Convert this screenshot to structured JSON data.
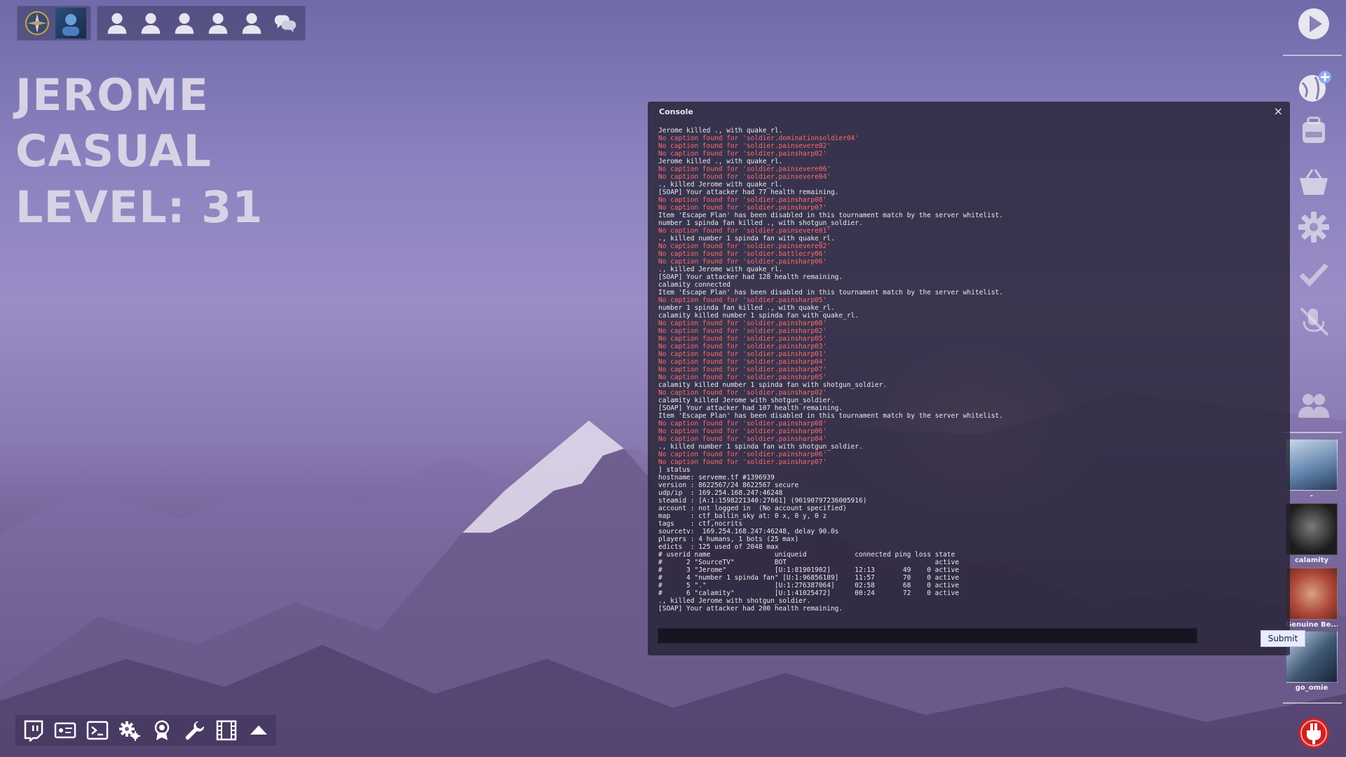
{
  "player": {
    "name": "JEROME",
    "mode": "CASUAL",
    "level": "LEVEL: 31"
  },
  "party_bar": {
    "icons": [
      "compass-icon",
      "avatar",
      "person-icon",
      "person-icon",
      "person-icon",
      "person-icon",
      "person-icon",
      "chat-bubbles-icon"
    ]
  },
  "console": {
    "title": "Console",
    "close_glyph": "×",
    "submit_label": "Submit",
    "input_value": "",
    "lines": [
      {
        "t": "Jerome killed ., with quake_rl.",
        "err": false
      },
      {
        "t": "No caption found for 'soldier.dominationsoldier04'",
        "err": true
      },
      {
        "t": "No caption found for 'soldier.painsevere02'",
        "err": true
      },
      {
        "t": "No caption found for 'soldier.painsharp02'",
        "err": true
      },
      {
        "t": "Jerome killed ., with quake_rl.",
        "err": false
      },
      {
        "t": "No caption found for 'soldier.painsevere06'",
        "err": true
      },
      {
        "t": "No caption found for 'soldier.painsevere04'",
        "err": true
      },
      {
        "t": "., killed Jerome with quake_rl.",
        "err": false
      },
      {
        "t": "[SOAP] Your attacker had 77 health remaining.",
        "err": false
      },
      {
        "t": "No caption found for 'soldier.painsharp08'",
        "err": true
      },
      {
        "t": "No caption found for 'soldier.painsharp07'",
        "err": true
      },
      {
        "t": "Item 'Escape Plan' has been disabled in this tournament match by the server whitelist.",
        "err": false
      },
      {
        "t": "number 1 spinda fan killed ., with shotgun_soldier.",
        "err": false
      },
      {
        "t": "No caption found for 'soldier.painsevere01'",
        "err": true
      },
      {
        "t": "., killed number 1 spinda fan with quake_rl.",
        "err": false
      },
      {
        "t": "No caption found for 'soldier.painsevere02'",
        "err": true
      },
      {
        "t": "No caption found for 'soldier.battlecry06'",
        "err": true
      },
      {
        "t": "No caption found for 'soldier.painsharp06'",
        "err": true
      },
      {
        "t": "., killed Jerome with quake_rl.",
        "err": false
      },
      {
        "t": "[SOAP] Your attacker had 128 health remaining.",
        "err": false
      },
      {
        "t": "calamity connected",
        "err": false
      },
      {
        "t": "Item 'Escape Plan' has been disabled in this tournament match by the server whitelist.",
        "err": false
      },
      {
        "t": "No caption found for 'soldier.painsharp05'",
        "err": true
      },
      {
        "t": "number 1 spinda fan killed ., with quake_rl.",
        "err": false
      },
      {
        "t": "calamity killed number 1 spinda fan with quake_rl.",
        "err": false
      },
      {
        "t": "No caption found for 'soldier.painsharp08'",
        "err": true
      },
      {
        "t": "No caption found for 'soldier.painsharp02'",
        "err": true
      },
      {
        "t": "No caption found for 'soldier.painsharp05'",
        "err": true
      },
      {
        "t": "No caption found for 'soldier.painsharp03'",
        "err": true
      },
      {
        "t": "No caption found for 'soldier.painsharp01'",
        "err": true
      },
      {
        "t": "No caption found for 'soldier.painsharp04'",
        "err": true
      },
      {
        "t": "No caption found for 'soldier.painsharp07'",
        "err": true
      },
      {
        "t": "No caption found for 'soldier.painsharp05'",
        "err": true
      },
      {
        "t": "calamity killed number 1 spinda fan with shotgun_soldier.",
        "err": false
      },
      {
        "t": "No caption found for 'soldier.painsharp02'",
        "err": true
      },
      {
        "t": "calamity killed Jerome with shotgun_soldier.",
        "err": false
      },
      {
        "t": "[SOAP] Your attacker had 107 health remaining.",
        "err": false
      },
      {
        "t": "Item 'Escape Plan' has been disabled in this tournament match by the server whitelist.",
        "err": false
      },
      {
        "t": "No caption found for 'soldier.painsharp08'",
        "err": true
      },
      {
        "t": "No caption found for 'soldier.painsharp06'",
        "err": true
      },
      {
        "t": "No caption found for 'soldier.painsharp04'",
        "err": true
      },
      {
        "t": "., killed number 1 spinda fan with shotgun_soldier.",
        "err": false
      },
      {
        "t": "No caption found for 'soldier.painsharp06'",
        "err": true
      },
      {
        "t": "No caption found for 'soldier.painsharp07'",
        "err": true
      },
      {
        "t": "] status",
        "err": false
      },
      {
        "t": "hostname: serveme.tf #1396939",
        "err": false
      },
      {
        "t": "version : 8622567/24 8622567 secure",
        "err": false
      },
      {
        "t": "udp/ip  : 169.254.168.247:46248",
        "err": false
      },
      {
        "t": "steamid : [A:1:1598221340:27661] (90190797236005916)",
        "err": false
      },
      {
        "t": "account : not logged in  (No account specified)",
        "err": false
      },
      {
        "t": "map     : ctf_ballin_sky at: 0 x, 0 y, 0 z",
        "err": false
      },
      {
        "t": "tags    : ctf,nocrits",
        "err": false
      },
      {
        "t": "sourcetv:  169.254.168.247:46248, delay 90.0s",
        "err": false
      },
      {
        "t": "players : 4 humans, 1 bots (25 max)",
        "err": false
      },
      {
        "t": "edicts  : 125 used of 2048 max",
        "err": false
      },
      {
        "t": "# userid name                uniqueid            connected ping loss state",
        "err": false
      },
      {
        "t": "#      2 \"SourceTV\"          BOT                                     active",
        "err": false
      },
      {
        "t": "#      3 \"Jerome\"            [U:1:81901902]      12:13       49    0 active",
        "err": false
      },
      {
        "t": "#      4 \"number 1 spinda fan\" [U:1:96856189]    11:57       70    0 active",
        "err": false
      },
      {
        "t": "#      5 \".\"                 [U:1:276387064]     02:58       68    0 active",
        "err": false
      },
      {
        "t": "#      6 \"calamity\"          [U:1:41025472]      00:24       72    0 active",
        "err": false
      },
      {
        "t": "., killed Jerome with shotgun_soldier.",
        "err": false
      },
      {
        "t": "[SOAP] Your attacker had 200 health remaining.",
        "err": false
      }
    ]
  },
  "right_sidebar": {
    "icons": [
      "play-icon",
      "globe-add-icon",
      "backpack-icon",
      "store-basket-icon",
      "gear-icon",
      "checkmark-icon",
      "muted-mic-icon",
      "friends-icon"
    ],
    "friends": [
      {
        "name": "-",
        "color": "#5e7fa8"
      },
      {
        "name": "calamity",
        "color": "#2a2a2a"
      },
      {
        "name": "Genuine Be...",
        "color": "#b04a3c"
      },
      {
        "name": "go_omie",
        "color": "#3e5672"
      }
    ],
    "power_icon": "power-plug-icon"
  },
  "bottom_toolbar": {
    "icons": [
      "twitch-icon",
      "replay-icon",
      "console-icon",
      "settings-gears-icon",
      "achievements-icon",
      "wrench-icon",
      "film-icon",
      "arrow-up-icon"
    ]
  },
  "colors": {
    "error_text": "#ff6b6b",
    "console_text": "#ececec",
    "sidebar_icon": "#e8e6ef",
    "power_red": "#d11f1f"
  }
}
